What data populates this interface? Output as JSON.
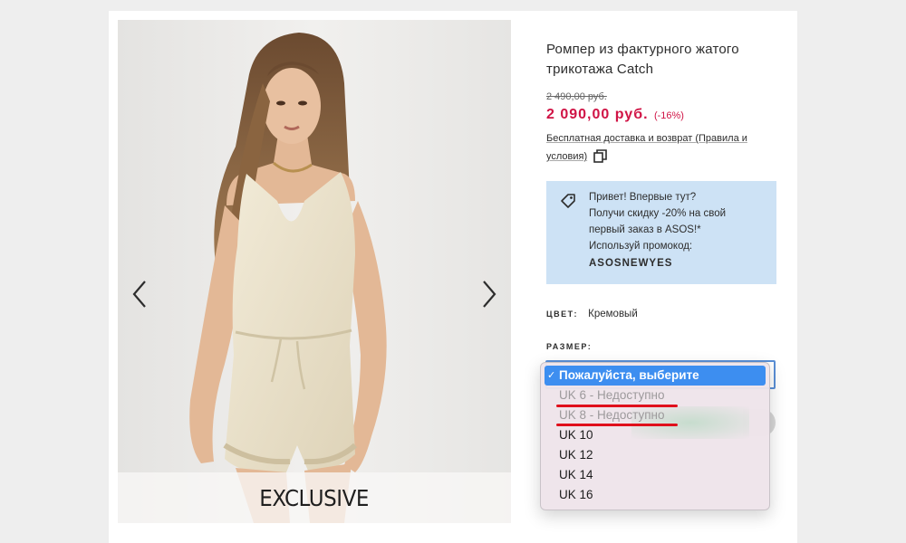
{
  "product": {
    "title": "Ромпер из фактурного жатого трикотажа Catch",
    "old_price": "2 490,00 руб.",
    "new_price": "2 090,00 руб.",
    "discount": "(-16%)",
    "delivery_prefix": "Бесплатная доставка и возврат (Правила и",
    "delivery_suffix": "условия)"
  },
  "gallery": {
    "badge": "EXCLUSIVE",
    "prev_icon": "chevron-left-icon",
    "next_icon": "chevron-right-icon"
  },
  "promo": {
    "line1": "Привет! Впервые тут?",
    "line2": "Получи скидку -20% на свой",
    "line3": "первый заказ в ASOS!*",
    "line4": "Используй промокод:",
    "code": "ASOSNEWYES",
    "icon": "tag-icon",
    "background": "#cde2f5"
  },
  "color": {
    "label": "ЦВЕТ:",
    "value": "Кремовый"
  },
  "size": {
    "label": "РАЗМЕР:",
    "options": [
      {
        "label": "Пожалуйста, выберите",
        "state": "selected"
      },
      {
        "label": "UK 6 - Недоступно",
        "state": "disabled"
      },
      {
        "label": "UK 8 - Недоступно",
        "state": "disabled"
      },
      {
        "label": "UK 10",
        "state": "available"
      },
      {
        "label": "UK 12",
        "state": "available"
      },
      {
        "label": "UK 14",
        "state": "available"
      },
      {
        "label": "UK 16",
        "state": "available"
      }
    ]
  },
  "colors": {
    "sale": "#d01345",
    "selection": "#3d8ef0",
    "annotation": "#e0101c"
  }
}
